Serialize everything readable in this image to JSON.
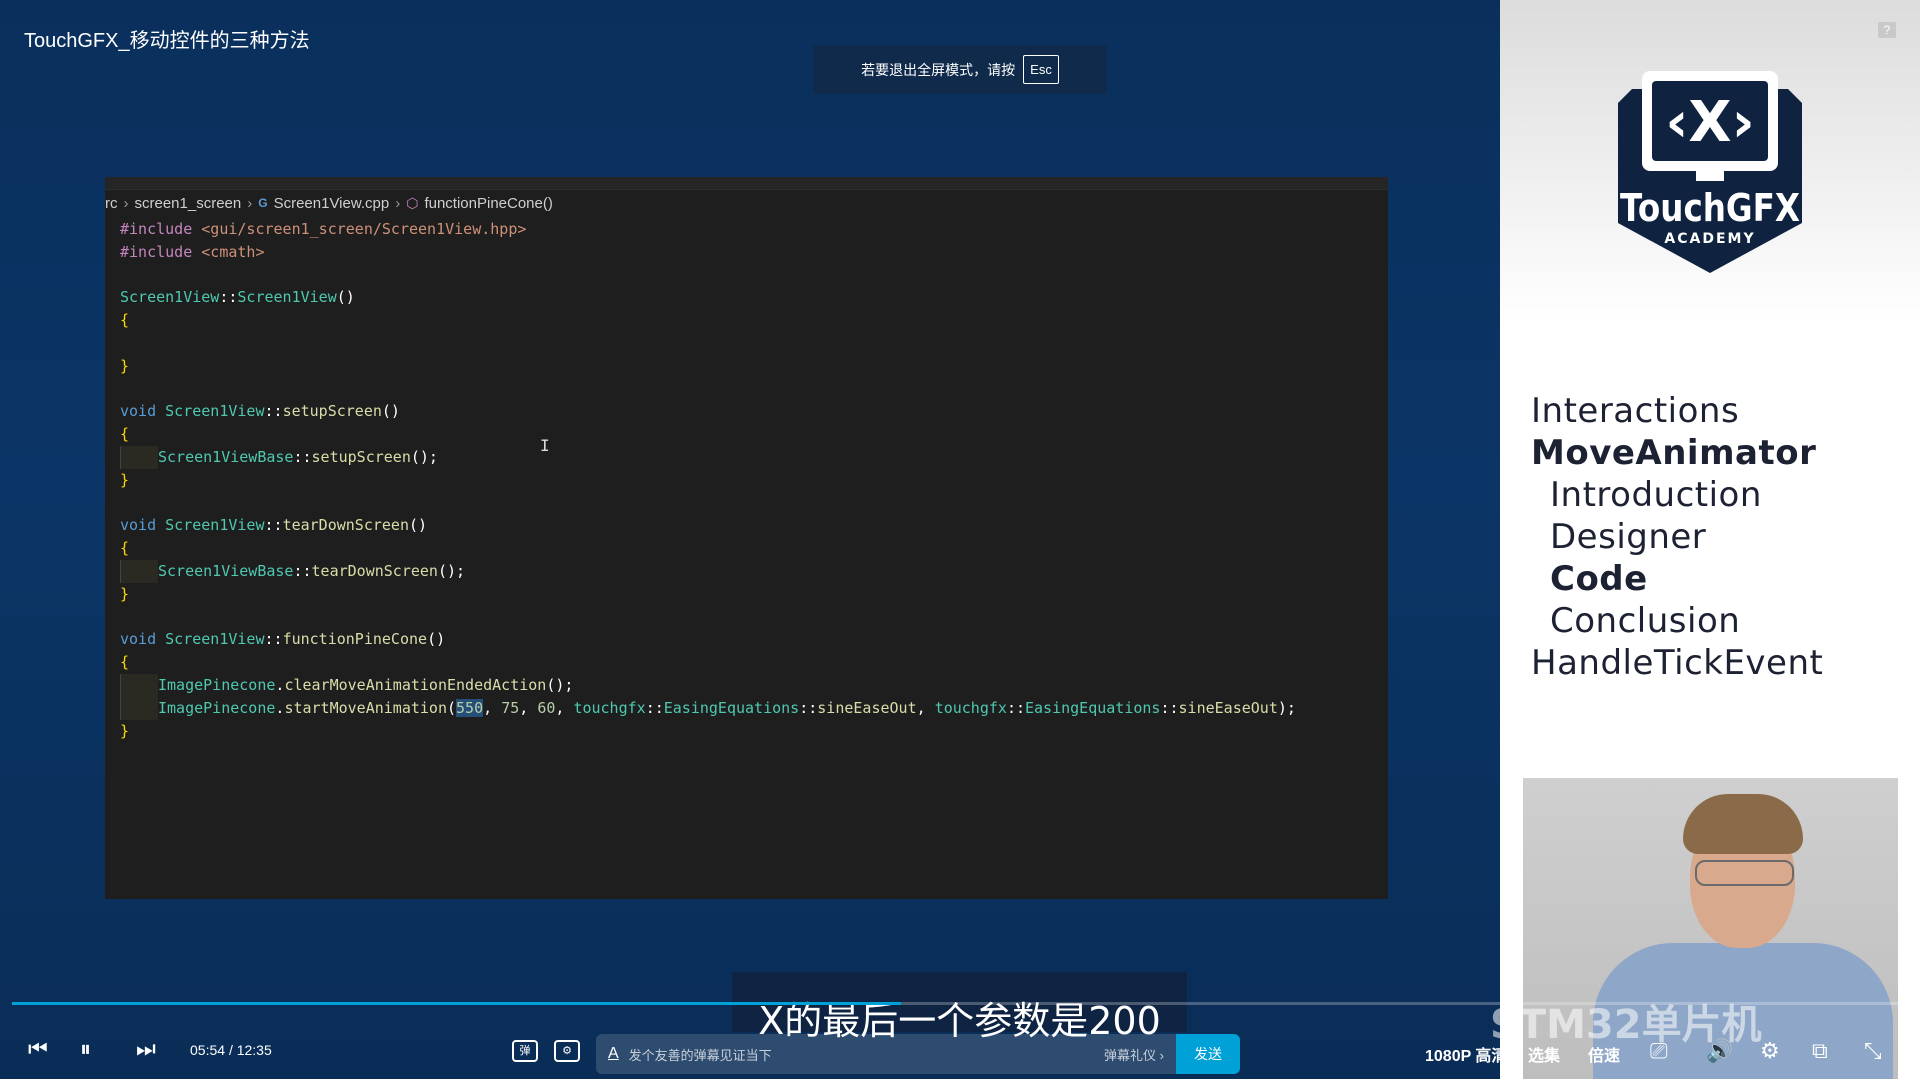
{
  "video_title": "TouchGFX_移动控件的三种方法",
  "fullscreen_toast": {
    "text": "若要退出全屏模式，请按",
    "key": "Esc"
  },
  "editor": {
    "breadcrumb": [
      "rc",
      "screen1_screen",
      "Screen1View.cpp",
      "functionPineCone()"
    ],
    "code_lines": [
      "#include <gui/screen1_screen/Screen1View.hpp>",
      "#include <cmath>",
      "",
      "Screen1View::Screen1View()",
      "{",
      "",
      "}",
      "",
      "void Screen1View::setupScreen()",
      "{",
      "    Screen1ViewBase::setupScreen();",
      "}",
      "",
      "void Screen1View::tearDownScreen()",
      "{",
      "    Screen1ViewBase::tearDownScreen();",
      "}",
      "",
      "void Screen1View::functionPineCone()",
      "{",
      "    ImagePinecone.clearMoveAnimationEndedAction();",
      "    ImagePinecone.startMoveAnimation(550, 75, 60, touchgfx::EasingEquations::sineEaseOut, touchgfx::EasingEquations::sineEaseOut);",
      "}"
    ]
  },
  "side_panel": {
    "logo_text": "TouchGFX",
    "logo_sub": "ACADEMY",
    "logo_symbol": "‹X›",
    "agenda": [
      {
        "label": "Interactions",
        "level": 0,
        "bold": false
      },
      {
        "label": "MoveAnimator",
        "level": 0,
        "bold": true
      },
      {
        "label": "Introduction",
        "level": 1,
        "bold": false
      },
      {
        "label": "Designer",
        "level": 1,
        "bold": false
      },
      {
        "label": "Code",
        "level": 1,
        "bold": true
      },
      {
        "label": "Conclusion",
        "level": 1,
        "bold": false
      },
      {
        "label": "HandleTickEvent",
        "level": 0,
        "bold": false
      }
    ]
  },
  "subtitle": "X的最后一个参数是200",
  "watermark": "STM32单片机",
  "player": {
    "current_time": "05:54",
    "separator": "/",
    "total_time": "12:35",
    "progress": 0.469,
    "danmaku_placeholder": "发个友善的弹幕见证当下",
    "danmaku_etiquette": "弹幕礼仪 ›",
    "send_label": "发送",
    "quality_label": "1080P 高清",
    "episodes_label": "选集",
    "speed_label": "倍速",
    "accent_color": "#00a1d6"
  }
}
